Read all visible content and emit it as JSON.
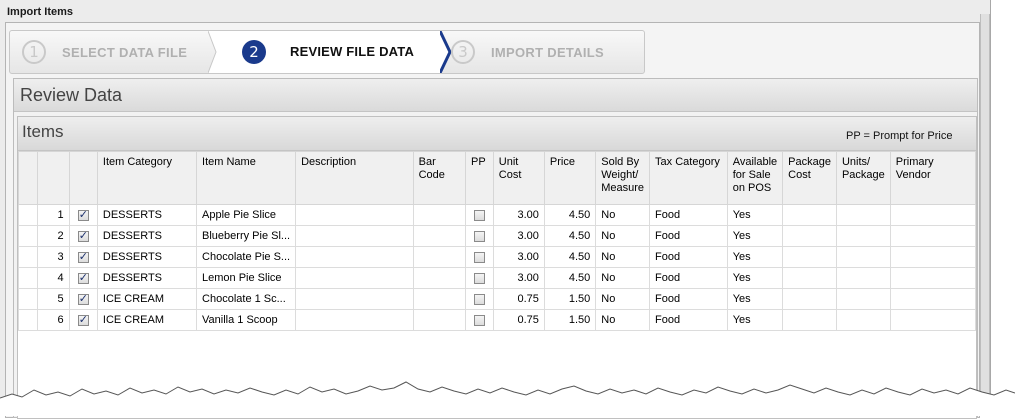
{
  "window": {
    "title": "Import Items"
  },
  "wizard": {
    "steps": [
      {
        "num": "1",
        "label": "SELECT DATA FILE",
        "state": "done"
      },
      {
        "num": "2",
        "label": "REVIEW FILE DATA",
        "state": "active"
      },
      {
        "num": "3",
        "label": "IMPORT DETAILS",
        "state": "pending"
      }
    ]
  },
  "review": {
    "title": "Review Data"
  },
  "items": {
    "title": "Items",
    "note": "PP = Prompt for Price",
    "columns": [
      "",
      "",
      "",
      "Item Category",
      "Item Name",
      "Description",
      "Bar Code",
      "PP",
      "Unit Cost",
      "Price",
      "Sold By Weight/ Measure",
      "Tax Category",
      "Available for Sale on POS",
      "Package Cost",
      "Units/ Package",
      "Primary Vendor"
    ],
    "rows": [
      {
        "n": "1",
        "selected": true,
        "category": "DESSERTS",
        "name": "Apple Pie Slice",
        "description": "",
        "barcode": "",
        "pp": false,
        "unit_cost": "3.00",
        "price": "4.50",
        "sold_by_weight": "No",
        "tax": "Food",
        "available": "Yes",
        "package_cost": "",
        "units_package": "",
        "vendor": ""
      },
      {
        "n": "2",
        "selected": true,
        "category": "DESSERTS",
        "name": "Blueberry Pie Sl...",
        "description": "",
        "barcode": "",
        "pp": false,
        "unit_cost": "3.00",
        "price": "4.50",
        "sold_by_weight": "No",
        "tax": "Food",
        "available": "Yes",
        "package_cost": "",
        "units_package": "",
        "vendor": ""
      },
      {
        "n": "3",
        "selected": true,
        "category": "DESSERTS",
        "name": "Chocolate Pie S...",
        "description": "",
        "barcode": "",
        "pp": false,
        "unit_cost": "3.00",
        "price": "4.50",
        "sold_by_weight": "No",
        "tax": "Food",
        "available": "Yes",
        "package_cost": "",
        "units_package": "",
        "vendor": ""
      },
      {
        "n": "4",
        "selected": true,
        "category": "DESSERTS",
        "name": "Lemon Pie Slice",
        "description": "",
        "barcode": "",
        "pp": false,
        "unit_cost": "3.00",
        "price": "4.50",
        "sold_by_weight": "No",
        "tax": "Food",
        "available": "Yes",
        "package_cost": "",
        "units_package": "",
        "vendor": ""
      },
      {
        "n": "5",
        "selected": true,
        "category": "ICE CREAM",
        "name": "Chocolate 1 Sc...",
        "description": "",
        "barcode": "",
        "pp": false,
        "unit_cost": "0.75",
        "price": "1.50",
        "sold_by_weight": "No",
        "tax": "Food",
        "available": "Yes",
        "package_cost": "",
        "units_package": "",
        "vendor": ""
      },
      {
        "n": "6",
        "selected": true,
        "category": "ICE CREAM",
        "name": "Vanilla 1 Scoop",
        "description": "",
        "barcode": "",
        "pp": false,
        "unit_cost": "0.75",
        "price": "1.50",
        "sold_by_weight": "No",
        "tax": "Food",
        "available": "Yes",
        "package_cost": "",
        "units_package": "",
        "vendor": ""
      }
    ]
  },
  "colors": {
    "accent": "#1a3a8c",
    "panel": "#ececec"
  }
}
